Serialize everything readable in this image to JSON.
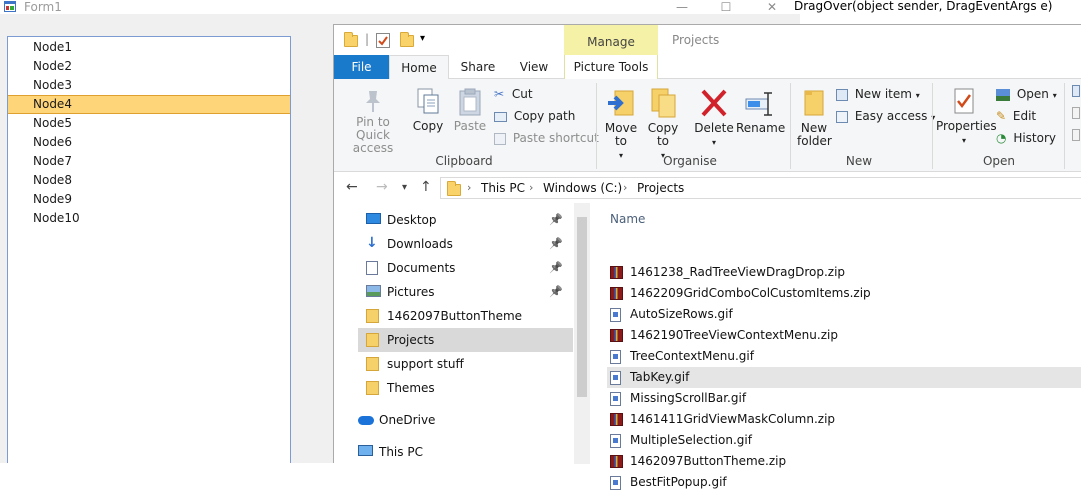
{
  "form1": {
    "title": "Form1",
    "window_buttons": {
      "minimize": "—",
      "maximize": "☐",
      "close": "✕"
    },
    "tree_nodes": [
      {
        "label": "Node1",
        "selected": false
      },
      {
        "label": "Node2",
        "selected": false
      },
      {
        "label": "Node3",
        "selected": false
      },
      {
        "label": "Node4",
        "selected": true
      },
      {
        "label": "Node5",
        "selected": false
      },
      {
        "label": "Node6",
        "selected": false
      },
      {
        "label": "Node7",
        "selected": false
      },
      {
        "label": "Node8",
        "selected": false
      },
      {
        "label": "Node9",
        "selected": false
      },
      {
        "label": "Node10",
        "selected": false
      }
    ]
  },
  "code_snippet": "DragOver(object sender, DragEventArgs e)",
  "explorer": {
    "title": "Projects",
    "context_tab": "Manage",
    "tabs": {
      "file": "File",
      "home": "Home",
      "share": "Share",
      "view": "View",
      "picture_tools": "Picture Tools"
    },
    "ribbon": {
      "clipboard": {
        "label": "Clipboard",
        "pin": "Pin to Quick access",
        "copy": "Copy",
        "paste": "Paste",
        "cut": "Cut",
        "copy_path": "Copy path",
        "paste_shortcut": "Paste shortcut"
      },
      "organise": {
        "label": "Organise",
        "move_to": "Move to",
        "copy_to": "Copy to",
        "delete": "Delete",
        "rename": "Rename"
      },
      "new": {
        "label": "New",
        "new_folder": "New folder",
        "new_item": "New item",
        "easy_access": "Easy access"
      },
      "open": {
        "label": "Open",
        "properties": "Properties",
        "open": "Open",
        "edit": "Edit",
        "history": "History"
      }
    },
    "breadcrumb": [
      "This PC",
      "Windows (C:)",
      "Projects"
    ],
    "nav_items": [
      {
        "label": "Desktop",
        "icon": "desktop-icon",
        "pinned": true
      },
      {
        "label": "Downloads",
        "icon": "downloads-icon",
        "pinned": true
      },
      {
        "label": "Documents",
        "icon": "documents-icon",
        "pinned": true
      },
      {
        "label": "Pictures",
        "icon": "pictures-icon",
        "pinned": true
      },
      {
        "label": "1462097ButtonTheme",
        "icon": "folder-icon",
        "pinned": false
      },
      {
        "label": "Projects",
        "icon": "folder-icon",
        "pinned": false,
        "selected": true
      },
      {
        "label": "support stuff",
        "icon": "folder-icon",
        "pinned": false
      },
      {
        "label": "Themes",
        "icon": "folder-icon",
        "pinned": false
      },
      {
        "label": "OneDrive",
        "icon": "onedrive-icon",
        "pinned": false
      },
      {
        "label": "This PC",
        "icon": "computer-icon",
        "pinned": false
      }
    ],
    "column_header": "Name",
    "files": [
      {
        "name": "1461238_RadTreeViewDragDrop.zip",
        "type": "zip"
      },
      {
        "name": "1462209GridComboColCustomItems.zip",
        "type": "zip"
      },
      {
        "name": "AutoSizeRows.gif",
        "type": "gif"
      },
      {
        "name": "1462190TreeViewContextMenu.zip",
        "type": "zip"
      },
      {
        "name": "TreeContextMenu.gif",
        "type": "gif"
      },
      {
        "name": "TabKey.gif",
        "type": "gif",
        "selected": true
      },
      {
        "name": "MissingScrollBar.gif",
        "type": "gif"
      },
      {
        "name": "1461411GridViewMaskColumn.zip",
        "type": "zip"
      },
      {
        "name": "MultipleSelection.gif",
        "type": "gif"
      },
      {
        "name": "1462097ButtonTheme.zip",
        "type": "zip"
      },
      {
        "name": "BestFitPopup.gif",
        "type": "gif"
      }
    ]
  }
}
